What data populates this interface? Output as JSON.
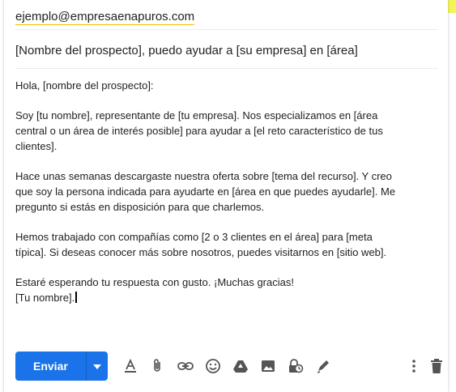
{
  "compose": {
    "to": "ejemplo@empresaenapuros.com",
    "subject": "[Nombre del prospecto], puedo ayudar a [su empresa] en [área]",
    "body": {
      "greeting": "Hola, [nombre del prospecto]:",
      "paragraph1": "Soy [tu nombre], representante de [tu empresa]. Nos especializamos en [área\ncentral o un área de interés posible] para ayudar a [el reto característico de tus\nclientes].",
      "paragraph2": "Hace unas semanas descargaste nuestra oferta sobre [tema del recurso]. Y creo\nque soy la persona indicada para ayudarte en [área en que puedes ayudarle].  Me\npregunto si estás en disposición para que charlemos.",
      "paragraph3": "Hemos trabajado con compañías como [2 o 3 clientes en el área] para [meta\ntípica]. Si deseas conocer más sobre nosotros, puedes visitarnos en [sitio web].",
      "closing": "Estaré esperando tu respuesta con gusto. ¡Muchas gracias!",
      "signature": "[Tu nombre]."
    }
  },
  "toolbar": {
    "send_label": "Enviar",
    "icons": [
      "formatting-icon",
      "attach-icon",
      "link-icon",
      "emoji-icon",
      "drive-icon",
      "photo-icon",
      "confidential-icon",
      "signature-icon",
      "more-options-icon",
      "trash-icon"
    ]
  },
  "colors": {
    "accent": "#1a73e8",
    "highlight": "#f2f55a",
    "to_underline": "#f0c000"
  }
}
